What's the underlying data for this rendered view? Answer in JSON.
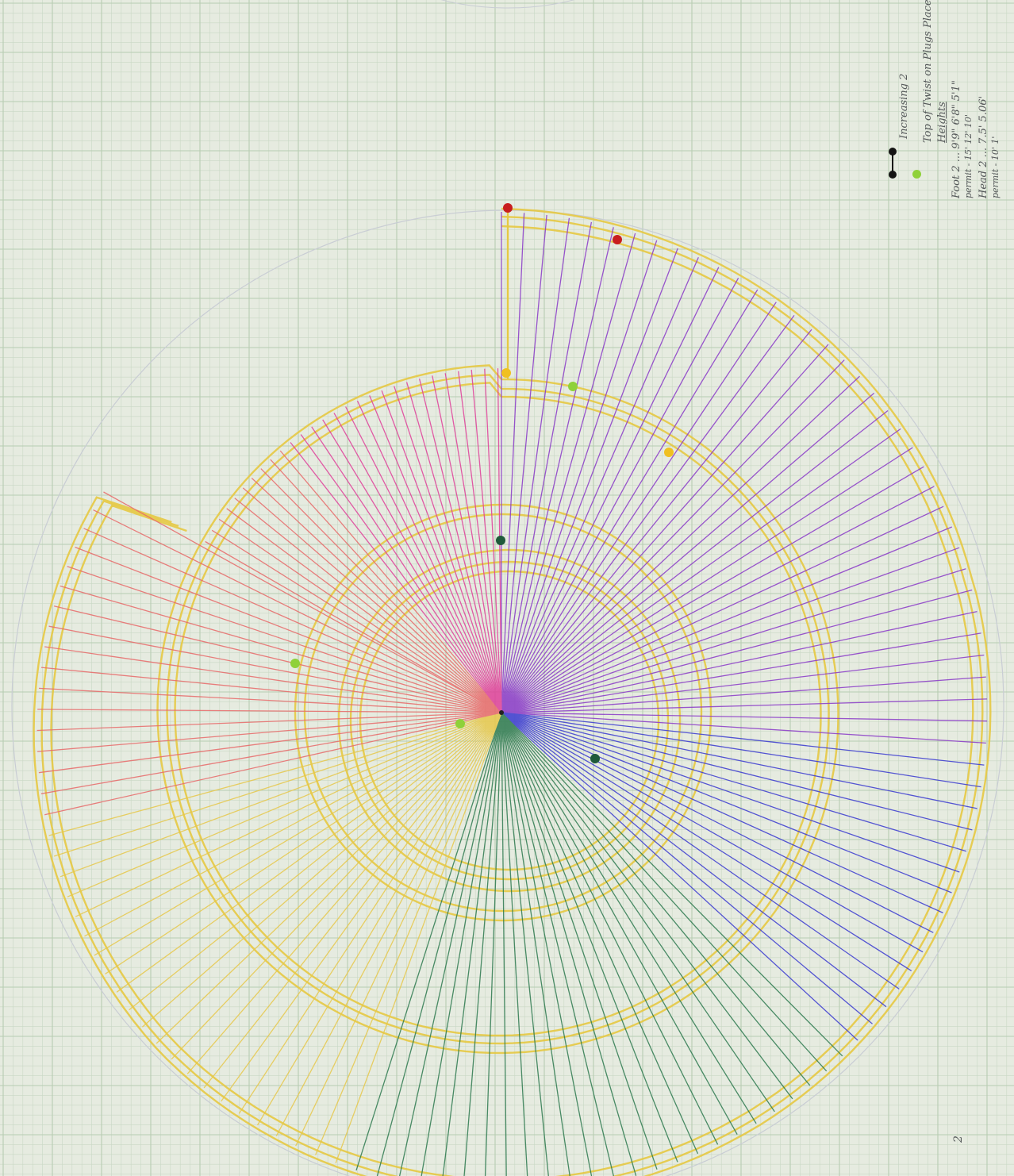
{
  "sheet": {
    "paper_color": "#e6ebe0",
    "fine_grid_color": "#c9d8c5",
    "major_grid_color": "#b7ccb2"
  },
  "legend": {
    "line1": "Increasing 2",
    "line2": "Top of Twist on Plugs Place",
    "line3": "Heights",
    "line4": "Foot 2 ... 9'9\" 6'8\" 5'1\"",
    "line5": "permit - 15' 12' 10'",
    "line6": "Head 2 ... 7.5' 5.06'",
    "line7": "permit - 10' 1'",
    "page_number": "2",
    "marker_colors": [
      "#141414",
      "#141414",
      "#8fd13a"
    ]
  },
  "diagram": {
    "ring_color": "#e6c943",
    "outline_color": "#c9cdd4",
    "ray_palette": [
      "#e7c84b",
      "#2d7a4f",
      "#3a3ad0",
      "#8a3ac8",
      "#e0409a",
      "#e86a6a"
    ],
    "markers": [
      {
        "id": "red-top",
        "color": "#c81e1e"
      },
      {
        "id": "red-2",
        "color": "#c81e1e"
      },
      {
        "id": "yellow-1",
        "color": "#f0c020"
      },
      {
        "id": "yellow-2",
        "color": "#f0c020"
      },
      {
        "id": "lime-1",
        "color": "#8fd13a"
      },
      {
        "id": "lime-2",
        "color": "#8fd13a"
      },
      {
        "id": "lime-3",
        "color": "#8fd13a"
      },
      {
        "id": "green-1",
        "color": "#1f5a3a"
      },
      {
        "id": "green-2",
        "color": "#1f5a3a"
      }
    ]
  }
}
